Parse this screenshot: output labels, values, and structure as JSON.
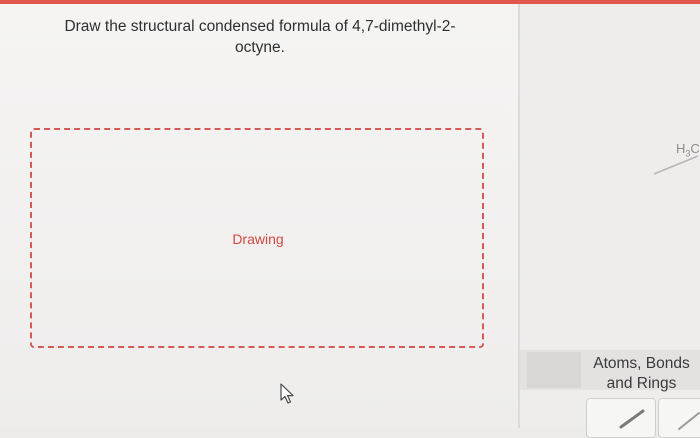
{
  "question": {
    "line1": "Draw the structural condensed formula of 4,7-dimethyl-2-",
    "line2": "octyne."
  },
  "drawing_area": {
    "label": "Drawing"
  },
  "side_panel": {
    "chem_label_main": "H",
    "chem_label_sub": "3",
    "chem_label_tail": "C",
    "section_line1": "Atoms, Bonds",
    "section_line2": "and Rings",
    "tools": [
      {
        "icon": "single-bond-icon"
      },
      {
        "icon": "bond-tool-icon"
      }
    ]
  },
  "colors": {
    "accent": "#e2564d",
    "drawing_border": "#d45a55",
    "drawing_label": "#cf4943"
  }
}
